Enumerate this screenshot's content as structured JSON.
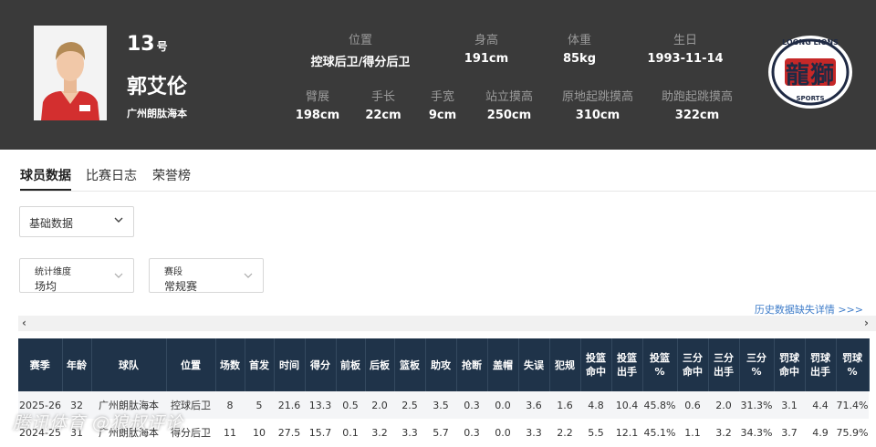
{
  "player": {
    "number": "13",
    "number_suffix": "号",
    "name": "郭艾伦",
    "team": "广州朗肽海本"
  },
  "stats_row1": [
    {
      "label": "位置",
      "value": "控球后卫/得分后卫"
    },
    {
      "label": "身高",
      "value": "191cm"
    },
    {
      "label": "体重",
      "value": "85kg"
    },
    {
      "label": "生日",
      "value": "1993-11-14"
    }
  ],
  "stats_row2": [
    {
      "label": "臂展",
      "value": "198cm"
    },
    {
      "label": "手长",
      "value": "22cm"
    },
    {
      "label": "手宽",
      "value": "9cm"
    },
    {
      "label": "站立摸高",
      "value": "250cm"
    },
    {
      "label": "原地起跳摸高",
      "value": "310cm"
    },
    {
      "label": "助跑起跳摸高",
      "value": "322cm"
    }
  ],
  "logo": {
    "top_text": "LOONG LIONS",
    "main_text": "龍獅",
    "bottom_text": "SPORTS",
    "icon": "loong-lions-logo"
  },
  "tabs": [
    "球员数据",
    "比赛日志",
    "荣誉榜"
  ],
  "data_type_select": {
    "value": "基础数据"
  },
  "filter_dimension": {
    "label": "统计维度",
    "value": "场均"
  },
  "filter_season_type": {
    "label": "赛段",
    "value": "常规赛"
  },
  "history_link": "历史数据缺失详情 >>>",
  "scroll": {
    "left": "‹",
    "right": "›"
  },
  "table": {
    "headers": [
      "赛季",
      "年龄",
      "球队",
      "位置",
      "场数",
      "首发",
      "时间",
      "得分",
      "前板",
      "后板",
      "篮板",
      "助攻",
      "抢断",
      "盖帽",
      "失误",
      "犯规",
      "投篮\n命中",
      "投篮\n出手",
      "投篮\n%",
      "三分\n命中",
      "三分\n出手",
      "三分\n%",
      "罚球\n命中",
      "罚球\n出手",
      "罚球\n%"
    ],
    "rows": [
      [
        "2025-26",
        "32",
        "广州朗肽海本",
        "控球后卫",
        "8",
        "5",
        "21.6",
        "13.3",
        "0.5",
        "2.0",
        "2.5",
        "3.5",
        "0.3",
        "0.0",
        "3.6",
        "1.6",
        "4.8",
        "10.4",
        "45.8%",
        "0.6",
        "2.0",
        "31.3%",
        "3.1",
        "4.4",
        "71.4%"
      ],
      [
        "2024-25",
        "31",
        "广州朗肽海本",
        "得分后卫",
        "11",
        "10",
        "27.5",
        "15.7",
        "0.1",
        "3.2",
        "3.3",
        "5.7",
        "0.3",
        "0.0",
        "3.3",
        "2.2",
        "5.5",
        "12.1",
        "45.1%",
        "1.1",
        "3.2",
        "34.3%",
        "3.7",
        "4.9",
        "75.9%"
      ]
    ]
  },
  "watermark": "腾讯体育 @狼叔评论",
  "colors": {
    "header_bg": "#3a3a3a",
    "table_header_bg": "#1f3349",
    "link": "#3e7cc9",
    "jersey_red": "#d32f2f"
  }
}
